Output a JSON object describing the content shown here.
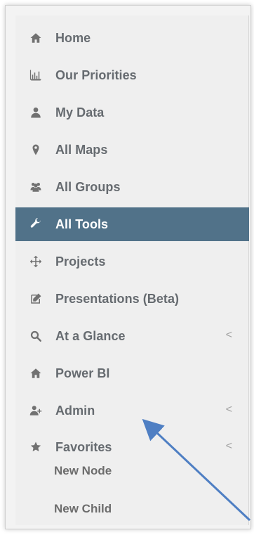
{
  "sidebar": {
    "items": [
      {
        "label": "Home",
        "icon": "home-icon"
      },
      {
        "label": "Our Priorities",
        "icon": "bar-chart-icon"
      },
      {
        "label": "My Data",
        "icon": "user-icon"
      },
      {
        "label": "All Maps",
        "icon": "map-pin-icon"
      },
      {
        "label": "All Groups",
        "icon": "users-icon"
      },
      {
        "label": "All Tools",
        "icon": "wrench-icon",
        "active": true
      },
      {
        "label": "Projects",
        "icon": "move-icon"
      },
      {
        "label": "Presentations (Beta)",
        "icon": "edit-icon"
      },
      {
        "label": "At a Glance",
        "icon": "search-icon",
        "chevron": "<"
      },
      {
        "label": "Power BI",
        "icon": "home-icon"
      },
      {
        "label": "Admin",
        "icon": "user-plus-icon",
        "chevron": "<"
      },
      {
        "label": "Favorites",
        "icon": "star-icon",
        "chevron": "<"
      }
    ],
    "sub_items": [
      {
        "label": "New Node"
      },
      {
        "label": "New Child"
      }
    ]
  },
  "colors": {
    "active_bg": "#517289",
    "text": "#666b70",
    "annotation_arrow": "#4f7fc3"
  }
}
